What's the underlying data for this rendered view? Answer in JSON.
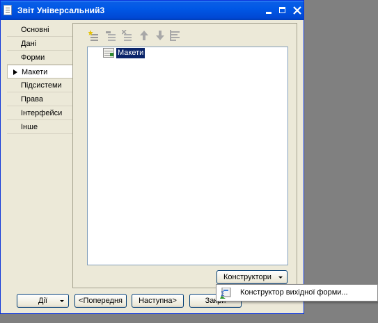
{
  "window": {
    "title": "Звіт Універсальний3"
  },
  "tabs": [
    {
      "label": "Основні",
      "active": false
    },
    {
      "label": "Дані",
      "active": false
    },
    {
      "label": "Форми",
      "active": false
    },
    {
      "label": "Макети",
      "active": true
    },
    {
      "label": "Підсистеми",
      "active": false
    },
    {
      "label": "Права",
      "active": false
    },
    {
      "label": "Інтерфейси",
      "active": false
    },
    {
      "label": "Інше",
      "active": false
    }
  ],
  "toolbar": {
    "icons": [
      "add-item-icon",
      "edit-item-icon",
      "delete-item-icon",
      "move-up-icon",
      "move-down-icon",
      "sort-icon"
    ]
  },
  "tree": {
    "items": [
      {
        "label": "Макети",
        "selected": true
      }
    ]
  },
  "constructors_button": {
    "label": "Конструктори"
  },
  "context_menu": {
    "items": [
      {
        "label": "Конструктор вихідної форми...",
        "icon": "form-constructor-icon"
      }
    ]
  },
  "bottom_buttons": {
    "actions": "Дії",
    "previous": "<Попередня",
    "next": "Наступна>",
    "close": "Закри"
  },
  "colors": {
    "titlebar": "#0058e6",
    "window_bg": "#ece9d8",
    "selection": "#0a246a",
    "desktop": "#808080"
  }
}
